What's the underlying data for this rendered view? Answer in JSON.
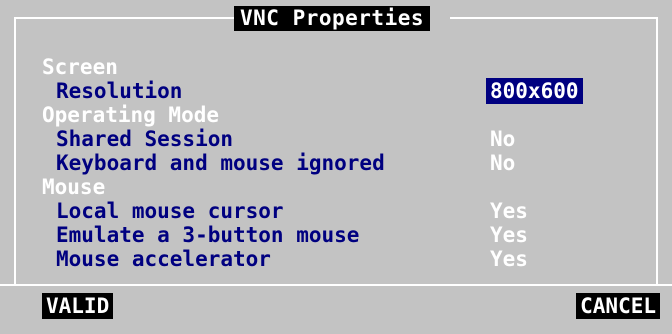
{
  "dialog": {
    "title": "VNC Properties"
  },
  "sections": {
    "screen": "Screen",
    "operating_mode": "Operating Mode",
    "mouse": "Mouse"
  },
  "items": {
    "resolution": {
      "label": "Resolution",
      "value": "800x600"
    },
    "shared_session": {
      "label": "Shared Session",
      "value": "No"
    },
    "keyboard_mouse_ignored": {
      "label": "Keyboard and mouse ignored",
      "value": "No"
    },
    "local_mouse_cursor": {
      "label": "Local mouse cursor",
      "value": "Yes"
    },
    "emulate_3_button": {
      "label": "Emulate a 3-button mouse",
      "value": "Yes"
    },
    "mouse_accelerator": {
      "label": "Mouse accelerator",
      "value": "Yes"
    }
  },
  "buttons": {
    "valid": "VALID",
    "cancel": "CANCEL"
  },
  "colors": {
    "background": "#c3c3c3",
    "label": "#000080",
    "highlight": "#000080",
    "text_light": "#ffffff"
  }
}
